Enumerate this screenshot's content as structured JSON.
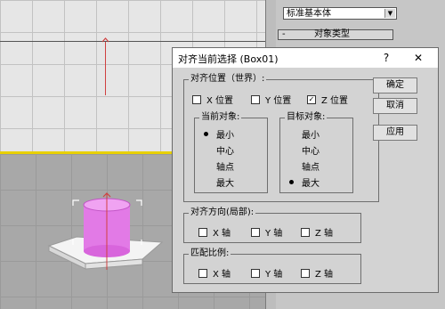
{
  "command_panel": {
    "dropdown_value": "标准基本体",
    "rollout_sign": "-",
    "rollout_label": "对象类型"
  },
  "dialog": {
    "title": "对齐当前选择 (Box01)",
    "help_glyph": "?",
    "close_glyph": "✕",
    "position_group": {
      "label": "对齐位置（世界）:",
      "x": {
        "label": "X 位置",
        "checked": false
      },
      "y": {
        "label": "Y 位置",
        "checked": false
      },
      "z": {
        "label": "Z 位置",
        "checked": true
      },
      "current_object": {
        "label": "当前对象:",
        "options": [
          "最小",
          "中心",
          "轴点",
          "最大"
        ],
        "selected": "最小"
      },
      "target_object": {
        "label": "目标对象:",
        "options": [
          "最小",
          "中心",
          "轴点",
          "最大"
        ],
        "selected": "最大"
      }
    },
    "orientation_group": {
      "label": "对齐方向(局部):",
      "x": {
        "label": "X 轴",
        "checked": false
      },
      "y": {
        "label": "Y 轴",
        "checked": false
      },
      "z": {
        "label": "Z 轴",
        "checked": false
      }
    },
    "scale_group": {
      "label": "匹配比例:",
      "x": {
        "label": "X 轴",
        "checked": false
      },
      "y": {
        "label": "Y 轴",
        "checked": false
      },
      "z": {
        "label": "Z 轴",
        "checked": false
      }
    },
    "buttons": {
      "ok": "确定",
      "cancel": "取消",
      "apply": "应用"
    }
  },
  "colors": {
    "cylinder": "#e27ae6",
    "active_viewport_border": "#e8d000",
    "axis_line": "#d04040"
  }
}
